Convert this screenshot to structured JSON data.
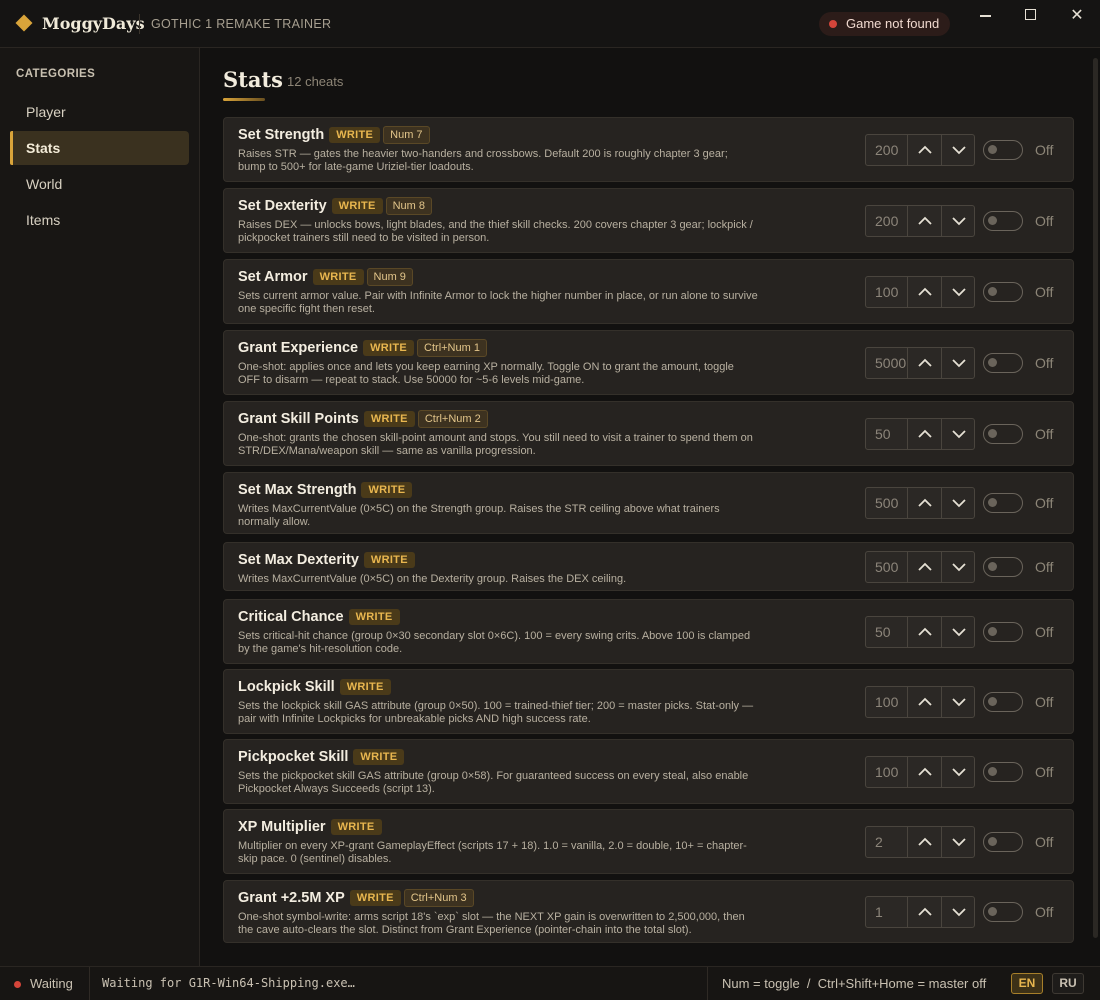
{
  "titlebar": {
    "brand": "MoggyDays",
    "subtitle": "GOTHIC 1 REMAKE TRAINER",
    "status": "Game not found",
    "status_color": "#d5453a",
    "close_symbol": "✕"
  },
  "sidebar": {
    "heading": "CATEGORIES",
    "items": [
      {
        "label": "Player",
        "active": false
      },
      {
        "label": "Stats",
        "active": true
      },
      {
        "label": "World",
        "active": false
      },
      {
        "label": "Items",
        "active": false
      }
    ]
  },
  "main": {
    "title": "Stats",
    "count": "12 cheats",
    "accent": "#d9a43a",
    "cards": [
      {
        "name": "Set Strength",
        "tag": "WRITE",
        "hotkey": "Num 7",
        "desc": "Raises STR — gates the heavier two-handers and crossbows. Default 200 is roughly chapter 3 gear; bump to 500+ for late-game Uriziel-tier loadouts.",
        "value": "200",
        "toggle": "Off"
      },
      {
        "name": "Set Dexterity",
        "tag": "WRITE",
        "hotkey": "Num 8",
        "desc": "Raises DEX — unlocks bows, light blades, and the thief skill checks. 200 covers chapter 3 gear; lockpick / pickpocket trainers still need to be visited in person.",
        "value": "200",
        "toggle": "Off"
      },
      {
        "name": "Set Armor",
        "tag": "WRITE",
        "hotkey": "Num 9",
        "desc": "Sets current armor value. Pair with Infinite Armor to lock the higher number in place, or run alone to survive one specific fight then reset.",
        "value": "100",
        "toggle": "Off"
      },
      {
        "name": "Grant Experience",
        "tag": "WRITE",
        "hotkey": "Ctrl+Num 1",
        "desc": "One-shot: applies once and lets you keep earning XP normally. Toggle ON to grant the amount, toggle OFF to disarm — repeat to stack. Use 50000 for ~5-6 levels mid-game.",
        "value": "5000",
        "toggle": "Off"
      },
      {
        "name": "Grant Skill Points",
        "tag": "WRITE",
        "hotkey": "Ctrl+Num 2",
        "desc": "One-shot: grants the chosen skill-point amount and stops. You still need to visit a trainer to spend them on STR/DEX/Mana/weapon skill — same as vanilla progression.",
        "value": "50",
        "toggle": "Off"
      },
      {
        "name": "Set Max Strength",
        "tag": "WRITE",
        "hotkey": "",
        "desc": "Writes MaxCurrentValue (0×5C) on the Strength group. Raises the STR ceiling above what trainers normally allow.",
        "value": "500",
        "toggle": "Off"
      },
      {
        "name": "Set Max Dexterity",
        "tag": "WRITE",
        "hotkey": "",
        "desc": "Writes MaxCurrentValue (0×5C) on the Dexterity group. Raises the DEX ceiling.",
        "value": "500",
        "toggle": "Off"
      },
      {
        "name": "Critical Chance",
        "tag": "WRITE",
        "hotkey": "",
        "desc": "Sets critical-hit chance (group 0×30 secondary slot 0×6C). 100 = every swing crits. Above 100 is clamped by the game's hit-resolution code.",
        "value": "50",
        "toggle": "Off"
      },
      {
        "name": "Lockpick Skill",
        "tag": "WRITE",
        "hotkey": "",
        "desc": "Sets the lockpick skill GAS attribute (group 0×50). 100 = trained-thief tier; 200 = master picks. Stat-only — pair with Infinite Lockpicks for unbreakable picks AND high success rate.",
        "value": "100",
        "toggle": "Off"
      },
      {
        "name": "Pickpocket Skill",
        "tag": "WRITE",
        "hotkey": "",
        "desc": "Sets the pickpocket skill GAS attribute (group 0×58). For guaranteed success on every steal, also enable Pickpocket Always Succeeds (script 13).",
        "value": "100",
        "toggle": "Off"
      },
      {
        "name": "XP Multiplier",
        "tag": "WRITE",
        "hotkey": "",
        "desc": "Multiplier on every XP-grant GameplayEffect (scripts 17 + 18). 1.0 = vanilla, 2.0 = double, 10+ = chapter-skip pace. 0 (sentinel) disables.",
        "value": "2",
        "toggle": "Off"
      },
      {
        "name": "Grant +2.5M XP",
        "tag": "WRITE",
        "hotkey": "Ctrl+Num 3",
        "desc": "One-shot symbol-write: arms script 18's `exp` slot — the NEXT XP gain is overwritten to 2,500,000, then the cave auto-clears the slot. Distinct from Grant Experience (pointer-chain into the total slot).",
        "value": "1",
        "toggle": "Off"
      }
    ]
  },
  "statusbar": {
    "status": "Waiting",
    "log": "Waiting for G1R-Win64-Shipping.exe…",
    "hint": "Num = toggle  /  Ctrl+Shift+Home = master off",
    "lang_en": "EN",
    "lang_ru": "RU"
  }
}
